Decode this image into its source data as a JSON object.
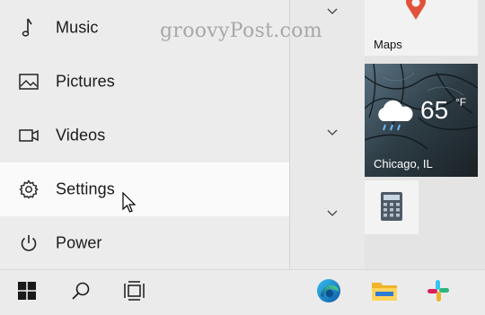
{
  "watermark": "groovyPost.com",
  "start_menu": {
    "items": [
      {
        "label": "Music",
        "icon": "music-note-icon"
      },
      {
        "label": "Pictures",
        "icon": "picture-icon"
      },
      {
        "label": "Videos",
        "icon": "video-camera-icon"
      },
      {
        "label": "Settings",
        "icon": "gear-icon",
        "hovered": true
      },
      {
        "label": "Power",
        "icon": "power-icon"
      }
    ]
  },
  "tiles": {
    "maps": {
      "label": "Maps",
      "icon": "map-pin-icon"
    },
    "weather": {
      "temperature": "65",
      "unit": "°F",
      "location": "Chicago, IL",
      "icon": "rain-cloud-icon"
    },
    "calculator": {
      "icon": "calculator-icon"
    }
  },
  "taskbar": {
    "items": [
      "windows-start-icon",
      "search-icon",
      "task-view-icon",
      "edge-icon",
      "file-explorer-icon",
      "slack-icon"
    ]
  },
  "colors": {
    "hover_bg": "#fafafa",
    "menu_bg": "#ececec",
    "taskbar_bg": "#ebebeb",
    "maps_pin": "#e0533a",
    "text": "#1a1a1a"
  }
}
